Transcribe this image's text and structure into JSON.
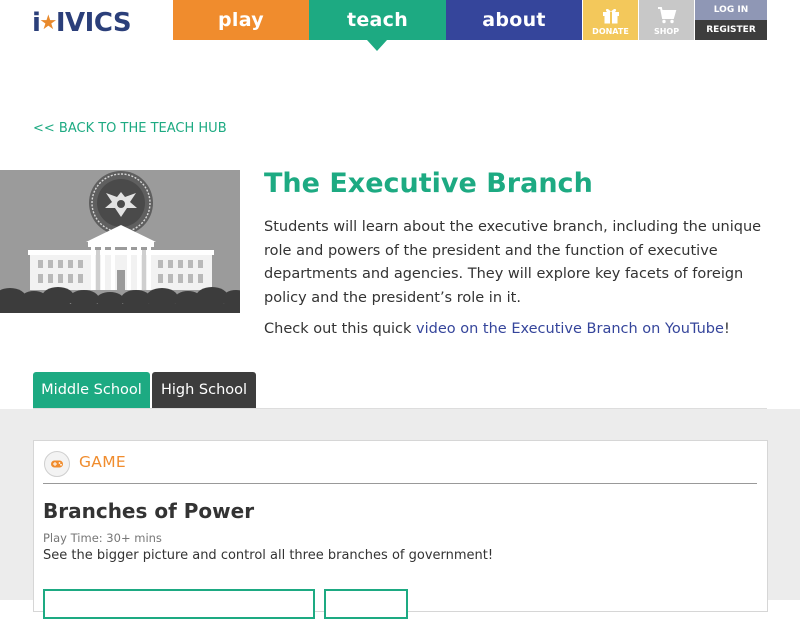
{
  "header": {
    "logo": {
      "prefix": "i",
      "suffix": "IVICS"
    },
    "nav": {
      "play": "play",
      "teach": "teach",
      "about": "about"
    },
    "utility": {
      "donate": "DONATE",
      "shop": "SHOP",
      "login": "LOG IN",
      "register": "REGISTER"
    }
  },
  "back_link": "<< BACK TO THE TEACH HUB",
  "hero": {
    "title": "The Executive Branch",
    "description": "Students will learn about the executive branch, including the unique role and powers of the president and the function of executive departments and agencies. They will explore key facets of foreign policy and the president’s role in it.",
    "video_prefix": "Check out this quick ",
    "video_link": "video on the Executive Branch on YouTube",
    "video_suffix": "!"
  },
  "tabs": {
    "middle": "Middle School",
    "high": "High School"
  },
  "card": {
    "type_label": "GAME",
    "title": "Branches of Power",
    "play_time": "Play Time: 30+ mins",
    "description": "See the bigger picture and control all three branches of government!"
  },
  "colors": {
    "green": "#1daa82",
    "orange": "#f08c2d",
    "navy": "#35459b",
    "gold": "#f3c85b",
    "dark": "#3d3d3d"
  },
  "icons": {
    "donate": "gift-icon",
    "shop": "cart-icon",
    "game": "gamepad-icon",
    "hero": "white-house-illustration"
  }
}
